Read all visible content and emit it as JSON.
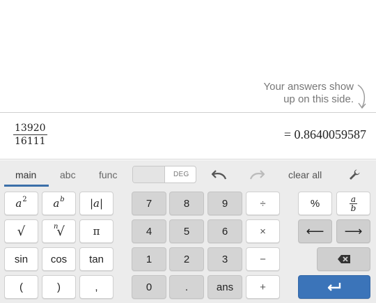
{
  "hint": {
    "line1": "Your answers show",
    "line2": "up on this side."
  },
  "expression": {
    "numerator": "13920",
    "denominator": "16111",
    "result": "= 0.8640059587"
  },
  "tabs": {
    "main": "main",
    "abc": "abc",
    "func": "func"
  },
  "toggle": {
    "label": "DEG"
  },
  "toolbar": {
    "clear_all": "clear all"
  },
  "keys": {
    "a_squared_base": "a",
    "a_squared_exp": "2",
    "a_power_base": "a",
    "a_power_exp": "b",
    "abs": "|a|",
    "sqrt": "√",
    "nth_root_index": "n",
    "nth_root": "√",
    "pi": "π",
    "sin": "sin",
    "cos": "cos",
    "tan": "tan",
    "lparen": "(",
    "rparen": ")",
    "comma": ",",
    "d7": "7",
    "d8": "8",
    "d9": "9",
    "divide": "÷",
    "d4": "4",
    "d5": "5",
    "d6": "6",
    "times": "×",
    "d1": "1",
    "d2": "2",
    "d3": "3",
    "minus": "−",
    "d0": "0",
    "dot": ".",
    "ans": "ans",
    "plus": "+",
    "percent": "%",
    "frac_num": "a",
    "frac_den": "b",
    "left": "⟵",
    "right": "⟶"
  },
  "icons": {
    "hint_arrow": "curved-down-arrow-icon",
    "undo": "undo-icon",
    "redo": "redo-icon",
    "settings": "wrench-icon",
    "backspace": "backspace-icon",
    "enter": "enter-icon"
  },
  "colors": {
    "accent": "#3b6fa9",
    "enter_key": "#3b74b9"
  }
}
